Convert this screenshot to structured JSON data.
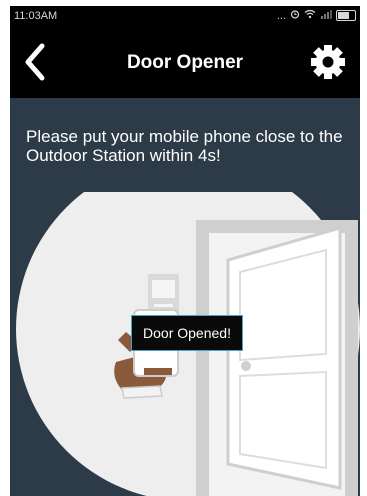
{
  "status_bar": {
    "time": "11:03AM",
    "icons": [
      "more-icon",
      "alarm-icon",
      "wifi-icon",
      "signal-icon",
      "battery-icon"
    ],
    "more_text": "..."
  },
  "app_bar": {
    "title": "Door Opener",
    "back_icon": "chevron-left-icon",
    "settings_icon": "gear-icon"
  },
  "main": {
    "instruction": "Please put your mobile phone close to the Outdoor Station within 4s!",
    "illustration": [
      "phone-in-hand-icon",
      "outdoor-station-icon",
      "open-door-icon"
    ]
  },
  "toast": {
    "message": "Door Opened!"
  },
  "colors": {
    "background": "#2d3a47",
    "app_bar": "#000000",
    "illustration_light": "#eeeeee",
    "illustration_mid": "#cfcfcf",
    "toast_border": "#4aa3c8"
  }
}
